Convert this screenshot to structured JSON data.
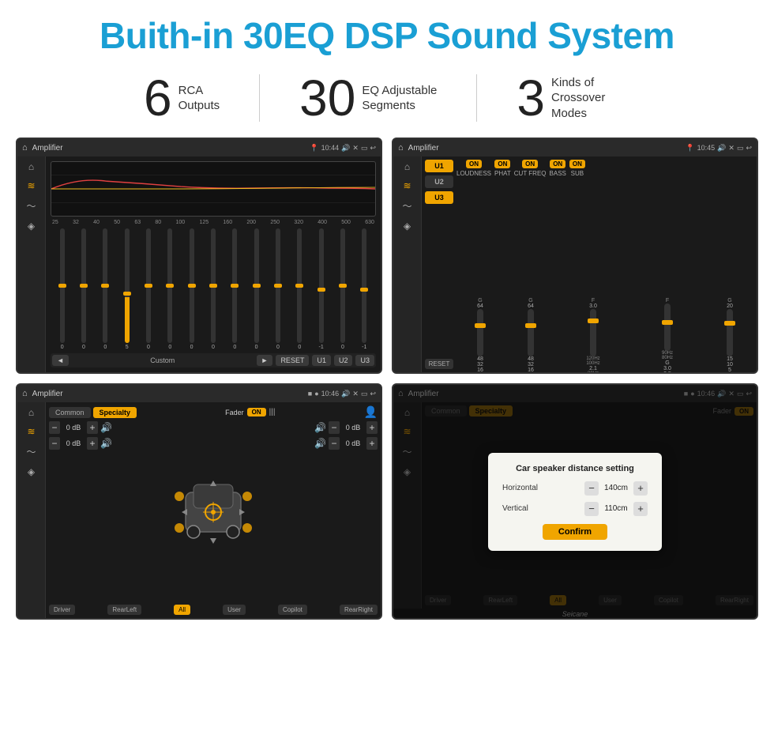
{
  "header": {
    "title": "Buith-in 30EQ DSP Sound System"
  },
  "stats": [
    {
      "number": "6",
      "label": "RCA\nOutputs"
    },
    {
      "number": "30",
      "label": "EQ Adjustable\nSegments"
    },
    {
      "number": "3",
      "label": "Kinds of\nCrossover Modes"
    }
  ],
  "screens": {
    "eq": {
      "title": "Amplifier",
      "time": "10:44",
      "freq_labels": [
        "25",
        "32",
        "40",
        "50",
        "63",
        "80",
        "100",
        "125",
        "160",
        "200",
        "250",
        "320",
        "400",
        "500",
        "630"
      ],
      "slider_values": [
        "0",
        "0",
        "0",
        "5",
        "0",
        "0",
        "0",
        "0",
        "0",
        "0",
        "0",
        "0",
        "-1",
        "0",
        "-1"
      ],
      "controls": {
        "prev": "◄",
        "label": "Custom",
        "next": "►",
        "reset": "RESET",
        "u1": "U1",
        "u2": "U2",
        "u3": "U3"
      }
    },
    "crossover": {
      "title": "Amplifier",
      "time": "10:45",
      "channels": [
        "U1",
        "U2",
        "U3"
      ],
      "toggles": [
        "LOUDNESS",
        "PHAT",
        "CUT FREQ",
        "BASS",
        "SUB"
      ],
      "toggle_states": [
        true,
        true,
        true,
        true,
        true
      ],
      "reset": "RESET"
    },
    "speaker": {
      "title": "Amplifier",
      "time": "10:46",
      "tabs": [
        "Common",
        "Specialty"
      ],
      "fader_label": "Fader",
      "fader_on": "ON",
      "db_values": [
        "0 dB",
        "0 dB",
        "0 dB",
        "0 dB"
      ],
      "bottom_btns": [
        "Driver",
        "RearLeft",
        "All",
        "User",
        "Copilot",
        "RearRight"
      ]
    },
    "speaker_dialog": {
      "title": "Amplifier",
      "time": "10:46",
      "tabs": [
        "Common",
        "Specialty"
      ],
      "dialog": {
        "title": "Car speaker distance setting",
        "horizontal_label": "Horizontal",
        "horizontal_value": "140cm",
        "vertical_label": "Vertical",
        "vertical_value": "110cm",
        "confirm_label": "Confirm"
      },
      "bottom_btns": [
        "Driver",
        "RearLeft",
        "All",
        "User",
        "Copilot",
        "RearRight"
      ],
      "watermark": "Seicane"
    }
  }
}
